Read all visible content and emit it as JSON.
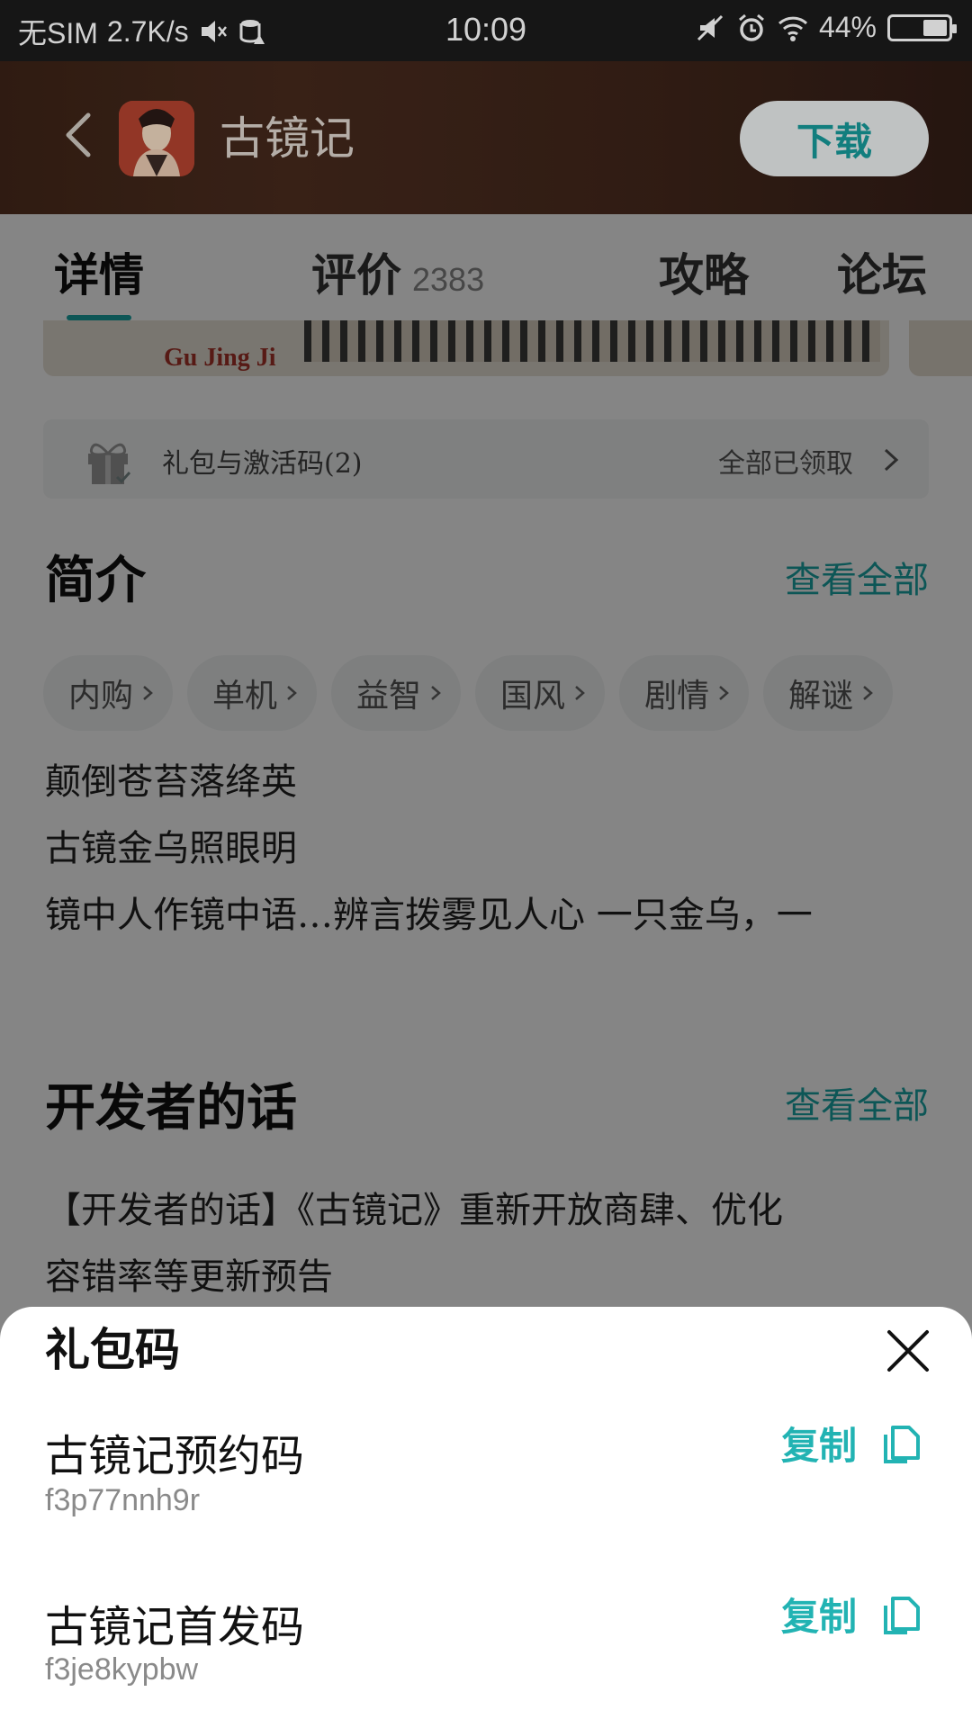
{
  "status_bar": {
    "carrier": "无SIM",
    "speed": "2.7K/s",
    "time": "10:09",
    "battery": "44%",
    "battery_level": 0.44
  },
  "header": {
    "app_title": "古镜记",
    "download_label": "下载"
  },
  "tabs": [
    {
      "label": "详情",
      "active": true
    },
    {
      "label": "评价",
      "count": "2383"
    },
    {
      "label": "攻略"
    },
    {
      "label": "论坛"
    }
  ],
  "banner": {
    "text": "Gu Jing Ji"
  },
  "gift": {
    "label": "礼包与激活码(2)",
    "status": "全部已领取"
  },
  "intro": {
    "title": "简介",
    "see_all": "查看全部",
    "tags": [
      "内购",
      "单机",
      "益智",
      "国风",
      "剧情",
      "解谜"
    ],
    "lines": [
      "颠倒苍苔落绛英",
      "古镜金乌照眼明",
      "镜中人作镜中语…辨言拨雾见人心  一只金乌，一"
    ]
  },
  "dev_notes": {
    "title": "开发者的话",
    "see_all": "查看全部",
    "lines": [
      "【开发者的话】《古镜记》重新开放商肆、优化",
      "容错率等更新预告"
    ]
  },
  "sheet": {
    "title": "礼包码",
    "copy_label": "复制",
    "codes": [
      {
        "name": "古镜记预约码",
        "code": "f3p77nnh9r"
      },
      {
        "name": "古镜记首发码",
        "code": "f3je8kypbw"
      }
    ]
  },
  "colors": {
    "accent": "#1aa6a6",
    "header_bg": "#3a2216"
  }
}
